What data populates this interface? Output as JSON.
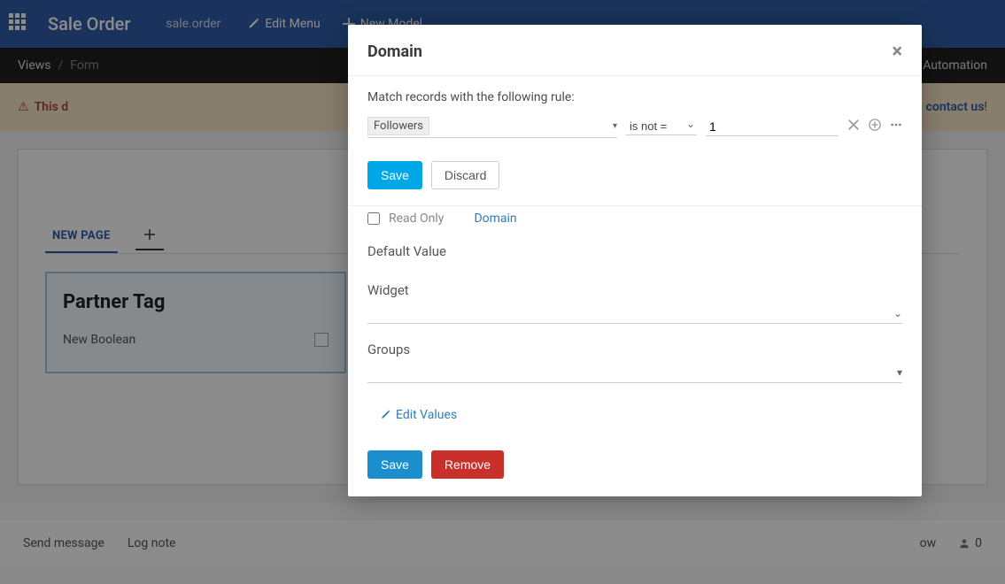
{
  "navbar": {
    "title": "Sale Order",
    "model": "sale.order",
    "edit_menu": "Edit Menu",
    "new_model": "New Model"
  },
  "secondbar": {
    "views": "Views",
    "current": "Form",
    "automation": "Automation"
  },
  "warnbar": {
    "prefix": "This d",
    "contact": "contact us",
    "suffix": " !"
  },
  "tabs": {
    "new_page": "NEW PAGE"
  },
  "panel": {
    "heading": "Partner Tag",
    "bool_label": "New Boolean"
  },
  "chatter": {
    "send": "Send message",
    "log": "Log note",
    "follow_tail": "ow",
    "count": "0"
  },
  "modal": {
    "title": "Domain",
    "rule_label": "Match records with the following rule:",
    "field_tag": "Followers",
    "operator": "is not =",
    "value": "1",
    "save": "Save",
    "discard": "Discard"
  },
  "side": {
    "read_only": "Read Only",
    "domain_link": "Domain",
    "default_value": "Default Value",
    "widget": "Widget",
    "groups": "Groups",
    "edit_values": "Edit Values",
    "save2": "Save",
    "remove": "Remove"
  }
}
